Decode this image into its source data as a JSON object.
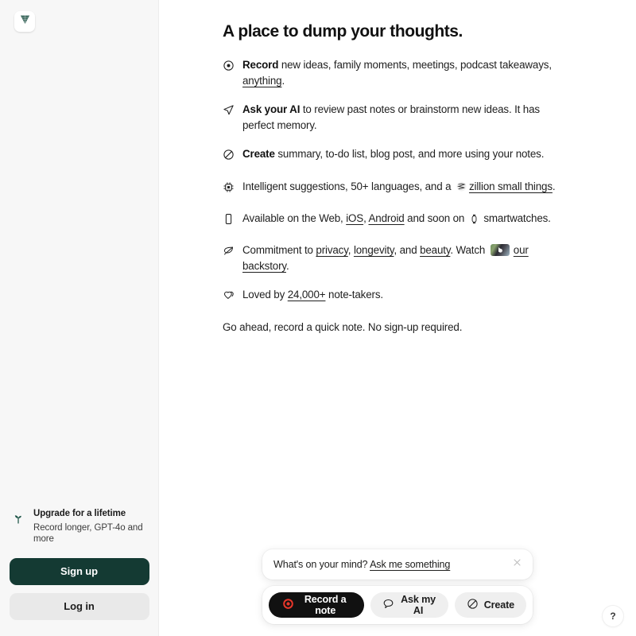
{
  "sidebar": {
    "logo_icon": "leaf-logo-icon",
    "upgrade": {
      "icon": "sprout-icon",
      "title": "Upgrade for a lifetime",
      "subtitle": "Record longer, GPT-4o and more"
    },
    "signup_label": "Sign up",
    "login_label": "Log in"
  },
  "main": {
    "headline": "A place to dump your thoughts.",
    "features": [
      {
        "icon": "record-dot-icon",
        "lead": "Record",
        "body_before": " new ideas, family moments, meetings, podcast takeaways, ",
        "link": "anything",
        "body_after": "."
      },
      {
        "icon": "paper-plane-icon",
        "lead": "Ask your AI",
        "body_before": " to review past notes or brainstorm new ideas. It has perfect memory.",
        "link": "",
        "body_after": ""
      },
      {
        "icon": "magic-wand-circle-icon",
        "lead": "Create",
        "body_before": " summary, to-do list, blog post, and more using your notes.",
        "link": "",
        "body_after": ""
      },
      {
        "icon": "cpu-chip-icon",
        "lead": "",
        "body_before": "Intelligent suggestions, 50+ languages, and a ",
        "emoji": "sphere-icon",
        "link": "zillion small things",
        "body_after": "."
      },
      {
        "icon": "mobile-phone-icon",
        "lead": "",
        "body_before": "Available on the Web, ",
        "link": "iOS",
        "link2": "Android",
        "mid": ", ",
        "body_mid": " and soon on ",
        "emoji": "smartwatch-icon",
        "body_after": " smartwatches."
      },
      {
        "icon": "leaf-icon",
        "lead": "",
        "body_before": "Commitment to ",
        "link": "privacy",
        "link2": "longevity",
        "link3": "beauty",
        "link4": "our backstory",
        "mid": ", ",
        "mid2": ", and ",
        "body_mid": ". Watch ",
        "thumbnail": "video-thumbnail",
        "body_after": "."
      },
      {
        "icon": "heart-icon",
        "lead": "",
        "body_before": "Loved by ",
        "link": "24,000+",
        "body_after": " note-takers."
      }
    ],
    "closing": "Go ahead, record a quick note. No sign-up required."
  },
  "dock": {
    "ask_bar": {
      "prompt": "What's on your mind? ",
      "link": "Ask me something",
      "close_icon": "close-icon"
    },
    "actions": [
      {
        "icon": "record-red-dot-icon",
        "label": "Record a note",
        "style": "dark"
      },
      {
        "icon": "speech-bubble-icon",
        "label": "Ask my AI",
        "style": "light"
      },
      {
        "icon": "magic-wand-circle-icon",
        "label": "Create",
        "style": "light"
      }
    ]
  },
  "help": {
    "label": "?"
  },
  "colors": {
    "sidebar_bg": "#f7f7f7",
    "primary_green": "#143a33",
    "record_red": "#e8362a",
    "dark_pill": "#111111",
    "light_pill": "#efefef"
  }
}
